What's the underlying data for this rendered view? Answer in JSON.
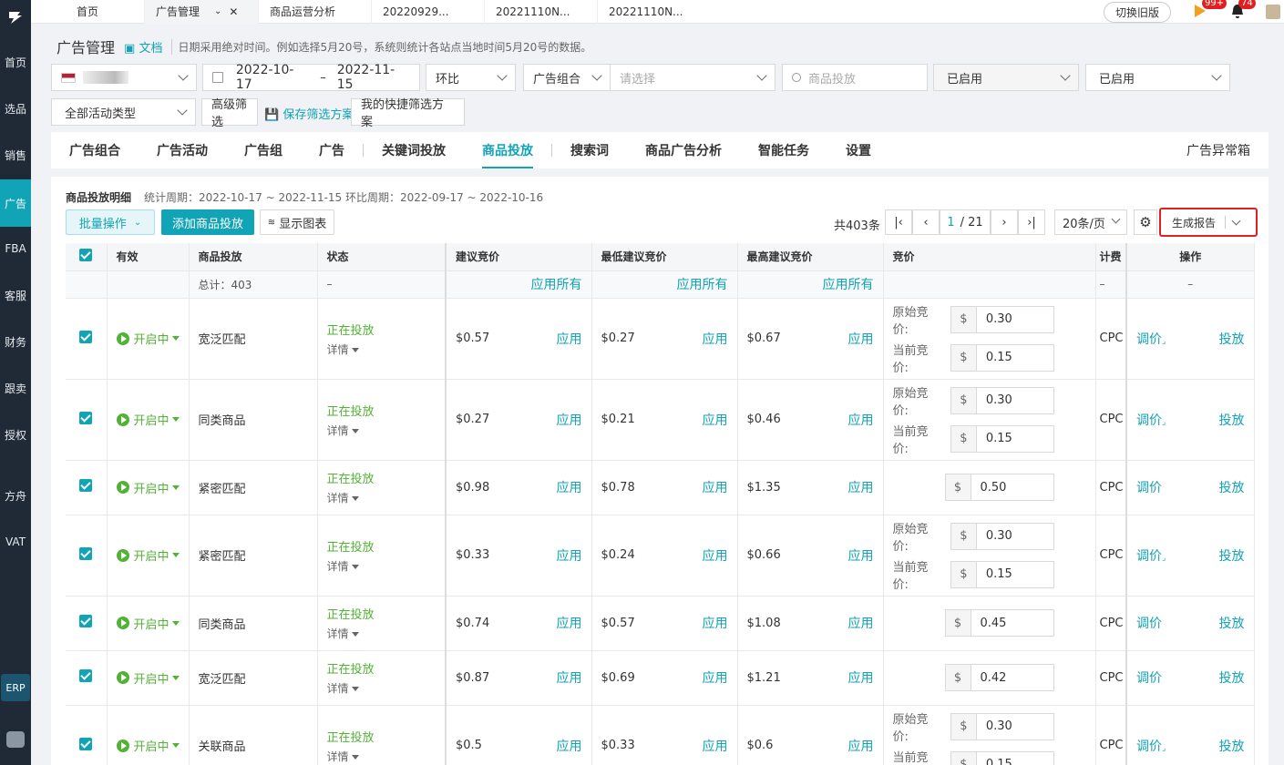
{
  "sidebar": {
    "items": [
      "首页",
      "选品",
      "销售",
      "广告",
      "FBA",
      "客服",
      "财务",
      "跟卖",
      "授权",
      "方舟",
      "VAT"
    ],
    "active": "广告",
    "erp": "ERP"
  },
  "topbar": {
    "tabs": [
      "首页",
      "广告管理",
      "商品运营分析",
      "20220929...",
      "20221110N...",
      "20221110N..."
    ],
    "switch_label": "切换旧版",
    "badge1": "99+",
    "badge2": "74"
  },
  "header": {
    "title": "广告管理",
    "doc_label": "文档",
    "hint": "日期采用绝对时间。例如选择5月20号，系统则统计各站点当地时间5月20号的数据。"
  },
  "filters": {
    "date_start": "2022-10-17",
    "date_sep": "–",
    "date_end": "2022-11-15",
    "compare": "环比",
    "group_label": "广告组合",
    "group_placeholder": "请选择",
    "search_placeholder": "商品投放",
    "status1": "已启用",
    "status2": "已启用",
    "activity_type": "全部活动类型",
    "advanced": "高级筛选",
    "save_scheme": "保存筛选方案",
    "my_schemes": "我的快捷筛选方案"
  },
  "tabs": {
    "items": [
      "广告组合",
      "广告活动",
      "广告组",
      "广告",
      "关键词投放",
      "商品投放",
      "搜索词",
      "商品广告分析",
      "智能任务",
      "设置"
    ],
    "active": "商品投放",
    "right": "广告异常箱"
  },
  "panel": {
    "title": "商品投放明细",
    "period": "统计周期：2022-10-17 ~ 2022-11-15 环比周期：2022-09-17 ~ 2022-10-16",
    "bulk_label": "批量操作",
    "add_label": "添加商品投放",
    "chart_label": "显示图表",
    "total_count": "共403条",
    "page_current": "1",
    "page_total": "/ 21",
    "page_size": "20条/页",
    "report_label": "生成报告"
  },
  "table": {
    "headers": [
      "有效",
      "商品投放",
      "状态",
      "建议竞价",
      "最低建议竞价",
      "最高建议竞价",
      "竞价",
      "计费",
      "操作"
    ],
    "total_label": "总计：403",
    "dash": "–",
    "apply_all": "应用所有",
    "apply": "应用",
    "enabled": "开启中",
    "status_live": "正在投放",
    "detail": "详情",
    "original_bid_label": "原始竞价:",
    "current_bid_label": "当前竞价:",
    "currency": "$",
    "adjust": "调价",
    "deliver": "投放",
    "rows": [
      {
        "target": "宽泛匹配",
        "suggested": "$0.57",
        "min": "$0.27",
        "max": "$0.67",
        "original": "0.30",
        "current": "0.15",
        "billing": "CPC"
      },
      {
        "target": "同类商品",
        "suggested": "$0.27",
        "min": "$0.21",
        "max": "$0.46",
        "original": "0.30",
        "current": "0.15",
        "billing": "CPC"
      },
      {
        "target": "紧密匹配",
        "suggested": "$0.98",
        "min": "$0.78",
        "max": "$1.35",
        "original": "",
        "current": "0.50",
        "billing": "CPC"
      },
      {
        "target": "紧密匹配",
        "suggested": "$0.33",
        "min": "$0.24",
        "max": "$0.66",
        "original": "0.30",
        "current": "0.15",
        "billing": "CPC"
      },
      {
        "target": "同类商品",
        "suggested": "$0.74",
        "min": "$0.57",
        "max": "$1.08",
        "original": "",
        "current": "0.45",
        "billing": "CPC"
      },
      {
        "target": "宽泛匹配",
        "suggested": "$0.87",
        "min": "$0.69",
        "max": "$1.21",
        "original": "",
        "current": "0.42",
        "billing": "CPC"
      },
      {
        "target": "关联商品",
        "suggested": "$0.5",
        "min": "$0.33",
        "max": "$0.6",
        "original": "0.30",
        "current": "0.15",
        "billing": "CPC"
      }
    ]
  }
}
